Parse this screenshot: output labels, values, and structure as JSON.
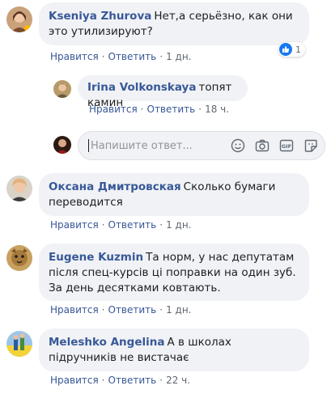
{
  "comments": [
    {
      "author": "Kseniya Zhurova",
      "text": "Нет,а серьёзно, как они это утилизируют?",
      "actions": {
        "like": "Нравится",
        "reply": "Ответить",
        "time": "1 дн."
      },
      "reaction_count": "1"
    },
    {
      "author": "Irina Volkonskaya",
      "text": "топят камин",
      "actions": {
        "like": "Нравится",
        "reply": "Ответить",
        "time": "18 ч."
      }
    },
    {
      "author": "Оксана Дмитровская",
      "text": "Сколько бумаги переводится",
      "actions": {
        "like": "Нравится",
        "reply": "Ответить",
        "time": "1 дн."
      }
    },
    {
      "author": "Eugene Kuzmin",
      "text": "Та норм, у нас депутатам після спец-курсів ці поправки на один зуб. За день десятками ковтають.",
      "actions": {
        "like": "Нравится",
        "reply": "Ответить",
        "time": "1 дн."
      }
    },
    {
      "author": "Meleshko Angelina",
      "text": "А в школах підручників не вистачає",
      "actions": {
        "like": "Нравится",
        "reply": "Ответить",
        "time": "22 ч."
      }
    }
  ],
  "reply_box": {
    "placeholder": "Напишите ответ...",
    "icons": [
      "emoji-icon",
      "camera-icon",
      "gif-icon",
      "sticker-icon"
    ]
  },
  "colors": {
    "bubble_bg": "#f0f2f5",
    "link": "#385898",
    "meta": "#606770",
    "like_blue": "#1877f2"
  }
}
